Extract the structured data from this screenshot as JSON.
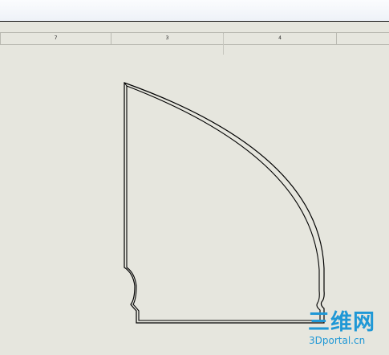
{
  "sheet": {
    "zone_labels": [
      "7",
      "3",
      "4"
    ]
  },
  "watermark": {
    "main": "三维网",
    "sub": "3Dportal.cn",
    "color": "#1f98d6"
  },
  "colors": {
    "background": "#e6e6de",
    "outline": "#000000"
  }
}
